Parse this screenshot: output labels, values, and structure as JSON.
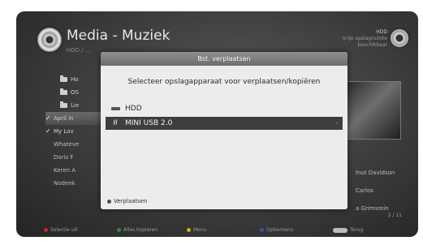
{
  "header": {
    "title": "Media - Muziek",
    "subtitle": "HDD / ...",
    "hdd_label": "HDD",
    "hdd_line1": "Vrije opslagruimte",
    "hdd_line2": "beschikbaar"
  },
  "list": {
    "folders": [
      "Ho",
      "OS",
      "Lie"
    ],
    "checked": [
      "April in",
      "My Lov"
    ],
    "plain": [
      "Whateve",
      "Doris F",
      "Keren A",
      "Nodenk"
    ]
  },
  "artists": [
    "lnut Davidson",
    "Carlos",
    "a Grimsrein"
  ],
  "footer": {
    "select": "Selectie uit",
    "select_all": "Alles kopieren",
    "menu": "Menu",
    "options": "Optiemenu",
    "back": "Terug",
    "page": "2 / 11"
  },
  "dialog": {
    "title": "Bst. verplaatsen",
    "prompt": "Selecteer opslagapparaat voor verplaatsen/kopiëren",
    "options": [
      {
        "label": "HDD",
        "icon": "hdd-icon"
      },
      {
        "label": "MINI USB 2.0",
        "icon": "usb-icon"
      }
    ],
    "footer_button": "Verplaatsen"
  },
  "colors": {
    "red": "#c62828",
    "green": "#2e8b3a",
    "yellow": "#d1b01a",
    "blue": "#2d58b3"
  }
}
